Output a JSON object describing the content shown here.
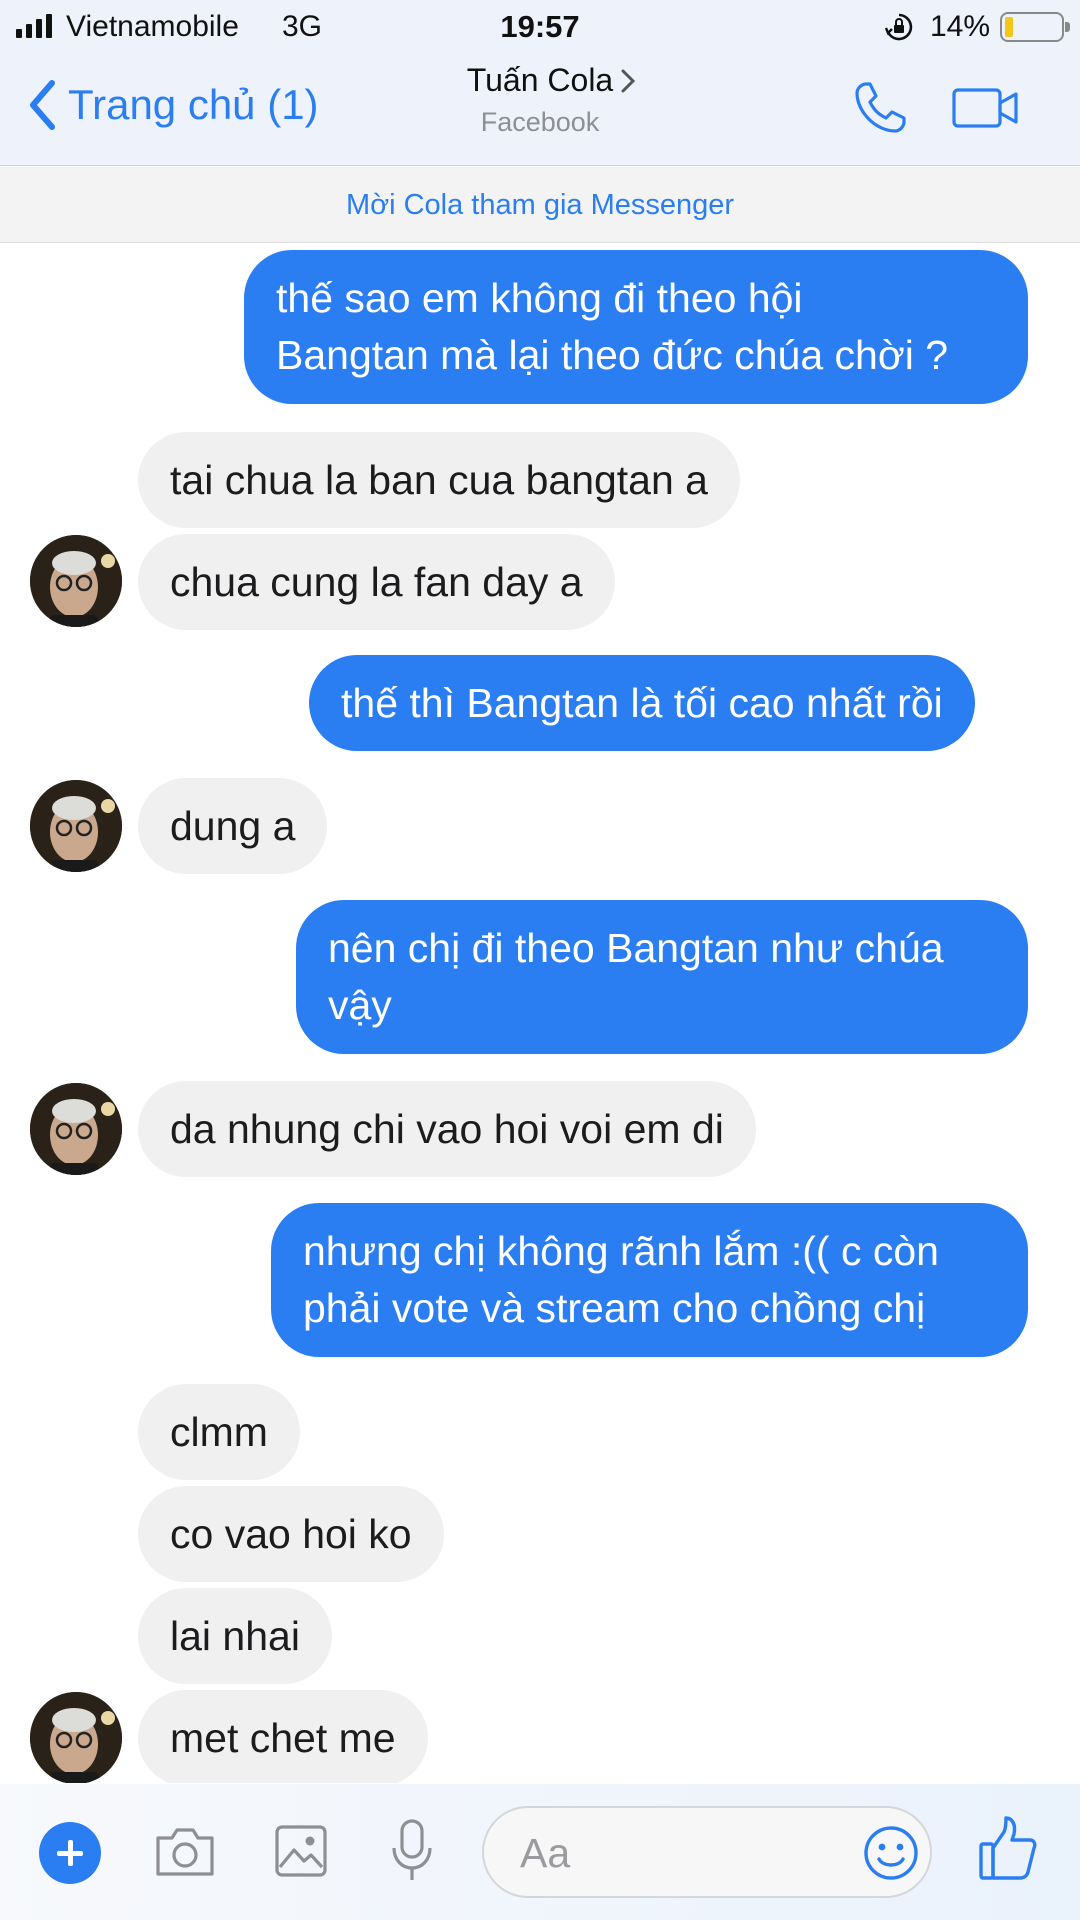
{
  "status_bar": {
    "carrier": "Vietnamobile",
    "network": "3G",
    "time": "19:57",
    "battery_percent": "14%",
    "battery_level": 0.14,
    "battery_fill_color": "#f5c518",
    "icons": [
      "signal-icon",
      "orientation-lock-icon",
      "battery-icon"
    ]
  },
  "header": {
    "back_label": "Trang chủ (1)",
    "title": "Tuấn Cola",
    "subtitle": "Facebook",
    "icons": [
      "back-chevron-icon",
      "title-chevron-icon",
      "phone-icon",
      "video-camera-icon"
    ]
  },
  "invite_banner": "Mời Cola tham gia Messenger",
  "messages": [
    {
      "direction": "out",
      "text": "thế sao em không đi theo hội Bangtan mà lại theo đức chúa chời ?",
      "lines": [
        "thế sao em không đi theo hội",
        "Bangtan mà lại theo đức chúa chời ?"
      ]
    },
    {
      "direction": "in",
      "text": "tai chua la ban cua bangtan a",
      "avatar": false
    },
    {
      "direction": "in",
      "text": "chua cung la fan day a",
      "avatar": true
    },
    {
      "direction": "out",
      "text": "thế thì Bangtan là tối cao nhất rồi"
    },
    {
      "direction": "in",
      "text": "dung a",
      "avatar": true
    },
    {
      "direction": "out",
      "text": "nên chị đi theo Bangtan như chúa vậy",
      "lines": [
        "nên chị đi theo Bangtan như chúa",
        "vậy"
      ]
    },
    {
      "direction": "in",
      "text": "da nhung chi vao hoi voi em di",
      "avatar": true
    },
    {
      "direction": "out",
      "text": "nhưng chị không rãnh lắm :(( c còn phải vote và stream cho chồng chị",
      "lines": [
        "nhưng chị không rãnh lắm :(( c còn",
        "phải vote và stream cho chồng chị"
      ]
    },
    {
      "direction": "in",
      "text": "clmm",
      "avatar": false
    },
    {
      "direction": "in",
      "text": "co vao hoi ko",
      "avatar": false
    },
    {
      "direction": "in",
      "text": "lai nhai",
      "avatar": false
    },
    {
      "direction": "in",
      "text": "met chet me",
      "avatar": true
    }
  ],
  "composer": {
    "placeholder": "Aa",
    "icons": [
      "plus-icon",
      "camera-icon",
      "image-icon",
      "microphone-icon",
      "emoji-icon",
      "thumbs-up-icon"
    ]
  },
  "colors": {
    "accent": "#2a7ef2",
    "outgoing_bubble": "#2a7ef2",
    "incoming_bubble": "#f0f0f0",
    "header_bg": "#eef3fb"
  }
}
